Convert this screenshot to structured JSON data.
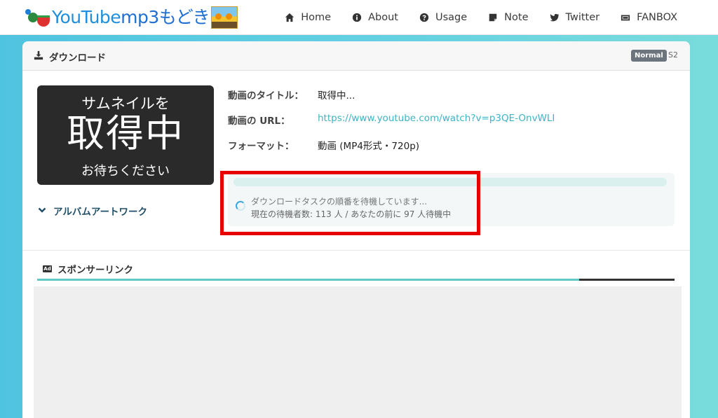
{
  "header": {
    "logo_text_en": "YouTube",
    "logo_text_jp": "mp3もどき",
    "nav": [
      {
        "label": "Home",
        "icon": "home-icon"
      },
      {
        "label": "About",
        "icon": "info-icon"
      },
      {
        "label": "Usage",
        "icon": "question-icon"
      },
      {
        "label": "Note",
        "icon": "note-icon"
      },
      {
        "label": "Twitter",
        "icon": "twitter-icon"
      },
      {
        "label": "FANBOX",
        "icon": "fanbox-icon"
      }
    ]
  },
  "download": {
    "title": "ダウンロード",
    "badge": "Normal",
    "server": "S2",
    "thumbnail": {
      "line1": "サムネイルを",
      "line2": "取得中",
      "line3": "お待ちください"
    },
    "album_toggle": "アルバムアートワーク",
    "info": {
      "title_label": "動画のタイトル：",
      "title_value": "取得中...",
      "url_label": "動画の URL：",
      "url_value": "https://www.youtube.com/watch?v=p3QE-OnvWLI",
      "format_label": "フォーマット：",
      "format_value": "動画 (MP4形式・720p)"
    },
    "queue": {
      "message": "ダウンロードタスクの順番を待機しています...",
      "status": "現在の待機者数: 113 人 / あなたの前に 97 人待機中",
      "progress": 0
    }
  },
  "sponsor": {
    "title": "スポンサーリンク",
    "ad_icon_label": "Ad"
  },
  "colors": {
    "accent": "#3cb4c4",
    "highlight": "#e60000",
    "brand_blue": "#1f8fdc"
  }
}
